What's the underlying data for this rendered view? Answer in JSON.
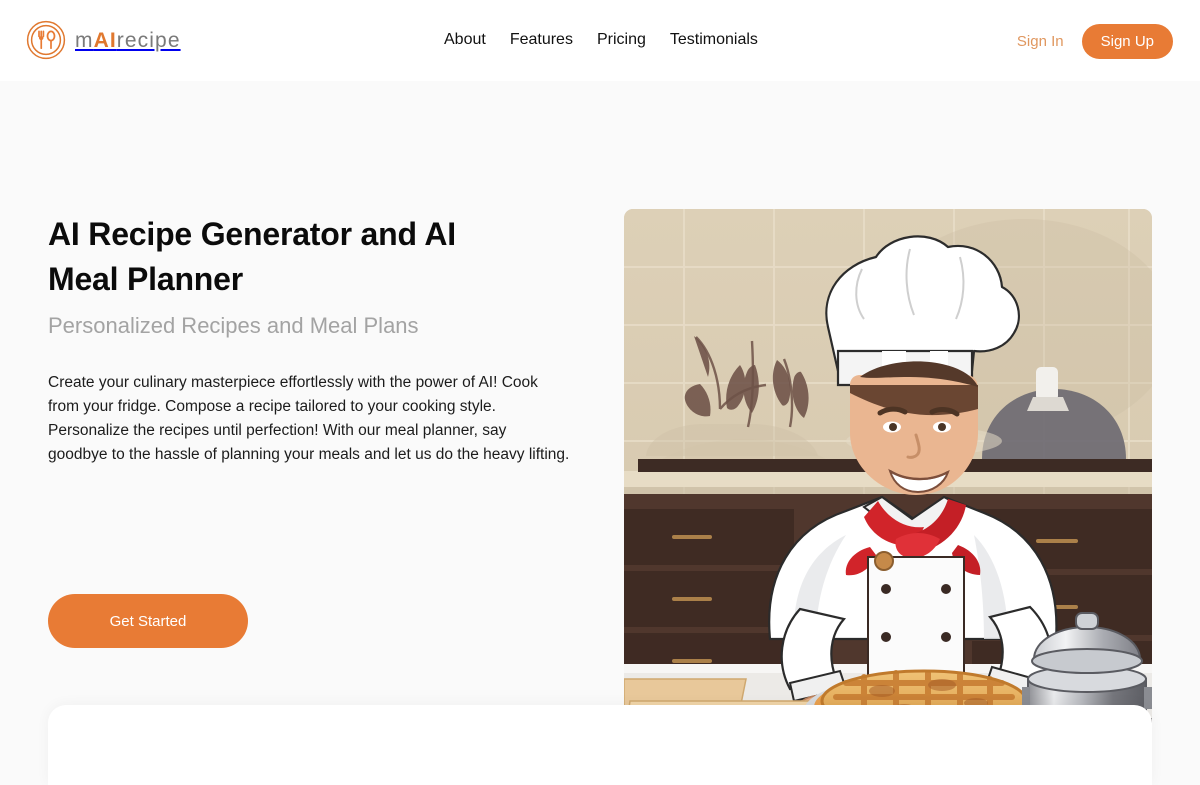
{
  "brand": {
    "logo_icon": "fork-spoon-circle-icon",
    "name_prefix": "m",
    "name_accent": "AI",
    "name_suffix": "recipe"
  },
  "nav": {
    "items": [
      {
        "label": "About"
      },
      {
        "label": "Features"
      },
      {
        "label": "Pricing"
      },
      {
        "label": "Testimonials"
      }
    ]
  },
  "auth": {
    "sign_in_label": "Sign In",
    "sign_up_label": "Sign Up"
  },
  "hero": {
    "title": "AI Recipe Generator and AI Meal Planner",
    "subtitle": "Personalized Recipes and Meal Plans",
    "body": "Create your culinary masterpiece effortlessly with the power of AI! Cook from your fridge. Compose a recipe tailored to your cooking style. Personalize the recipes until perfection! With our meal planner, say goodbye to the hassle of planning your meals and let us do the heavy lifting.",
    "cta_label": "Get Started",
    "illustration": "chef-with-lattice-pie-in-kitchen-illustration"
  },
  "colors": {
    "accent": "#e87b35",
    "accent_soft": "#e0975f",
    "logo_gray": "#7a7a7a",
    "heading": "#0b0b0b",
    "subtitle_gray": "#a3a3a3",
    "body_text": "#1c1c1c",
    "page_bg": "#fafafa",
    "header_bg": "#ffffff",
    "card_bg": "#ffffff"
  }
}
